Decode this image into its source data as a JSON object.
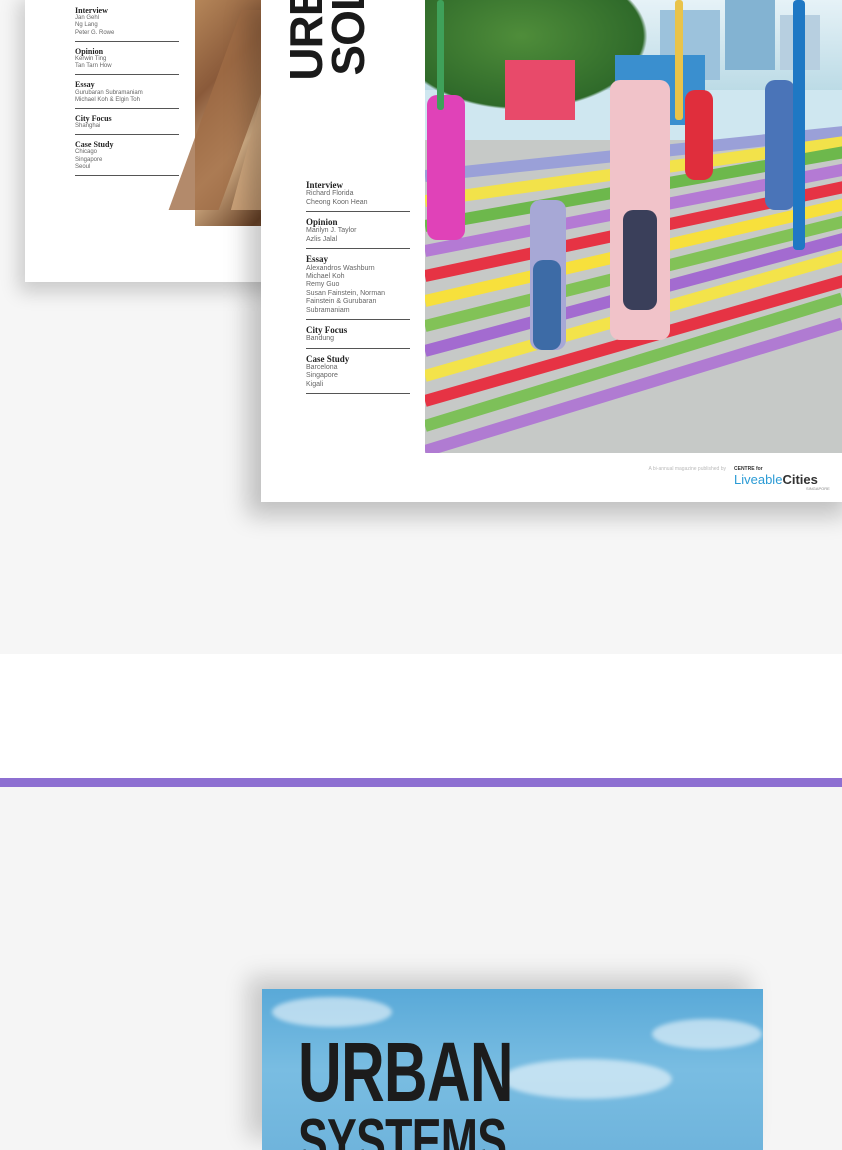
{
  "magazine_back": {
    "toc": [
      {
        "heading": "Interview",
        "items": [
          "Jan Gehl",
          "Ng Lang",
          "Peter G. Rowe"
        ]
      },
      {
        "heading": "Opinion",
        "items": [
          "Kerwin Ting",
          "Tan Tarn How"
        ]
      },
      {
        "heading": "Essay",
        "items": [
          "Gurubaran Subramaniam",
          "Michael Koh & Elgin Toh"
        ]
      },
      {
        "heading": "City Focus",
        "items": [
          "Shanghai"
        ]
      },
      {
        "heading": "Case Study",
        "items": [
          "Chicago",
          "Singapore",
          "Seoul"
        ]
      }
    ]
  },
  "magazine_front": {
    "title_line1": "URB",
    "title_line2": "SOL",
    "toc": [
      {
        "heading": "Interview",
        "items": [
          "Richard Florida",
          "Cheong Koon Hean"
        ]
      },
      {
        "heading": "Opinion",
        "items": [
          "Marilyn J. Taylor",
          "Azlis Jalal"
        ]
      },
      {
        "heading": "Essay",
        "items": [
          "Alexandros Washburn",
          "Michael Koh",
          "Remy Guo",
          "Susan Fainstein, Norman Fainstein & Gurubaran Subramaniam"
        ]
      },
      {
        "heading": "City Focus",
        "items": [
          "Bandung"
        ]
      },
      {
        "heading": "Case Study",
        "items": [
          "Barcelona",
          "Singapore",
          "Kigali"
        ]
      }
    ],
    "publisher_note": "A bi-annual magazine published by",
    "publisher_centre": "CENTRE for",
    "publisher_brand_a": "Liveable",
    "publisher_brand_b": "Cities",
    "publisher_country": "SINGAPORE"
  },
  "book": {
    "title_line1": "URBAN",
    "title_line2": "SYSTEMS"
  },
  "colors": {
    "divider": "#8d6fd1",
    "brand_blue": "#2b9bd5"
  }
}
